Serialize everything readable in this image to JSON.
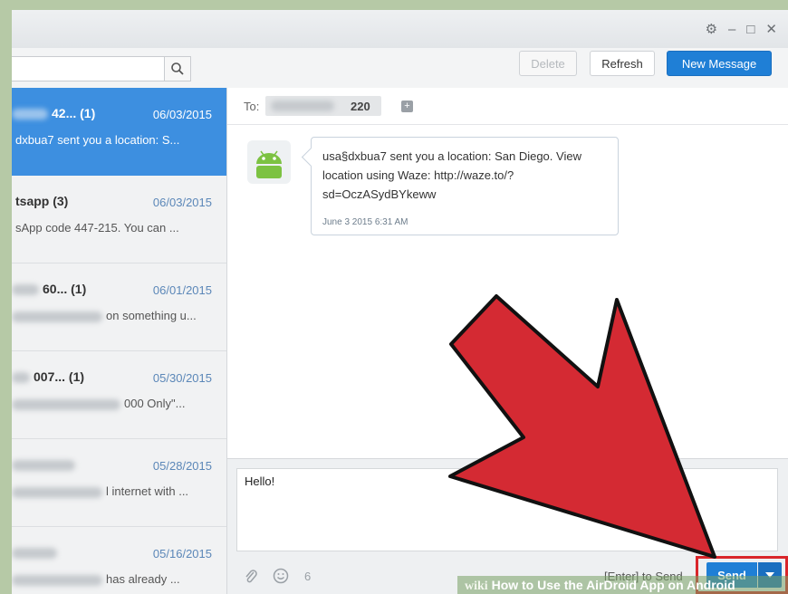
{
  "toolbar": {
    "delete_label": "Delete",
    "refresh_label": "Refresh",
    "new_message_label": "New Message"
  },
  "conversations": [
    {
      "name": "42...  (1)",
      "date": "06/03/2015",
      "preview": "dxbua7 sent you a location: S..."
    },
    {
      "name": "tsapp (3)",
      "date": "06/03/2015",
      "preview": "sApp code 447-215. You can ..."
    },
    {
      "name": "60...  (1)",
      "date": "06/01/2015",
      "preview": "on something u..."
    },
    {
      "name": "007...  (1)",
      "date": "05/30/2015",
      "preview": "000 Only\"..."
    },
    {
      "name": "",
      "date": "05/28/2015",
      "preview": "l internet with ..."
    },
    {
      "name": "",
      "date": "05/16/2015",
      "preview": "has already ..."
    }
  ],
  "recipient": {
    "to_label": "To:",
    "number_suffix": "220"
  },
  "message": {
    "text": "usa§dxbua7 sent you a location: San Diego. View location using Waze: http://waze.to/?sd=OczASydBYkeww",
    "time": "June 3 2015 6:31 AM"
  },
  "compose": {
    "text": "Hello!",
    "char_count": "6",
    "hint": "[Enter] to Send",
    "send_label": "Send"
  },
  "watermark": {
    "brand": "wiki",
    "text": "How to Use the AirDroid App on Android"
  },
  "colors": {
    "accent": "#1f7fd6",
    "active_row": "#3d8fe0",
    "annotation_arrow": "#d9262b"
  }
}
